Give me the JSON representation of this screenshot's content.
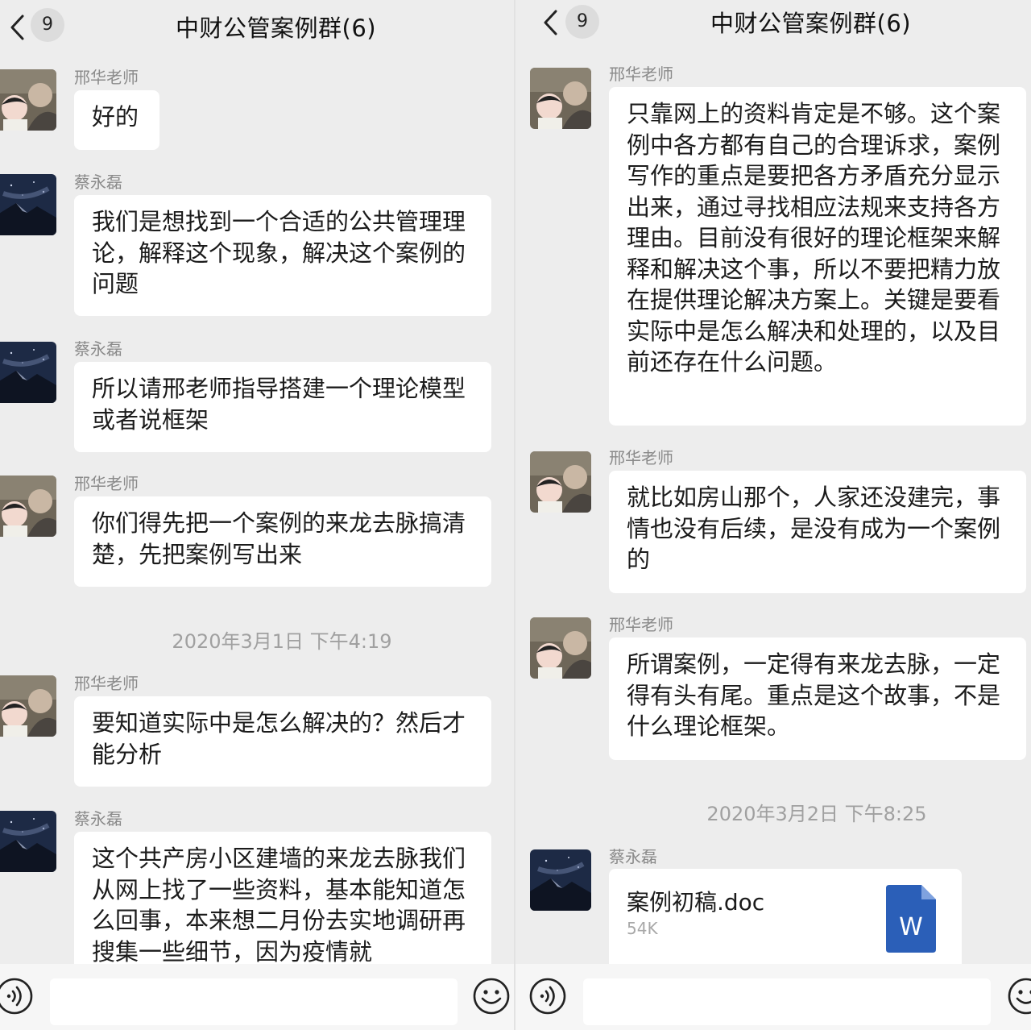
{
  "left": {
    "header": {
      "title": "中财公管案例群(6)",
      "unread_count": "9"
    },
    "messages": [
      {
        "sender": "邢华老师",
        "avatar": "teacher-avatar",
        "text": "好的"
      },
      {
        "sender": "蔡永磊",
        "avatar": "student-avatar",
        "text": "我们是想找到一个合适的公共管理理论，解释这个现象，解决这个案例的问题"
      },
      {
        "sender": "蔡永磊",
        "avatar": "student-avatar",
        "text": "所以请邢老师指导搭建一个理论模型或者说框架"
      },
      {
        "sender": "邢华老师",
        "avatar": "teacher-avatar",
        "text": "你们得先把一个案例的来龙去脉搞清楚，先把案例写出来"
      },
      {
        "sender": "邢华老师",
        "avatar": "teacher-avatar",
        "text": "要知道实际中是怎么解决的？然后才能分析"
      },
      {
        "sender": "蔡永磊",
        "avatar": "student-avatar",
        "text": "这个共产房小区建墙的来龙去脉我们从网上找了一些资料，基本能知道怎么回事，本来想二月份去实地调研再搜集一些细节，因为疫情就"
      }
    ],
    "timestamp": "2020年3月1日 下午4:19",
    "input": {
      "placeholder": ""
    }
  },
  "right": {
    "header": {
      "title": "中财公管案例群(6)",
      "unread_count": "9"
    },
    "messages": [
      {
        "sender": "邢华老师",
        "avatar": "teacher-avatar",
        "text": "只靠网上的资料肯定是不够。这个案例中各方都有自己的合理诉求，案例写作的重点是要把各方矛盾充分显示出来，通过寻找相应法规来支持各方理由。目前没有很好的理论框架来解释和解决这个事，所以不要把精力放在提供理论解决方案上。关键是要看实际中是怎么解决和处理的，以及目前还存在什么问题。"
      },
      {
        "sender": "邢华老师",
        "avatar": "teacher-avatar",
        "text": "就比如房山那个，人家还没建完，事情也没有后续，是没有成为一个案例的"
      },
      {
        "sender": "邢华老师",
        "avatar": "teacher-avatar",
        "text": "所谓案例，一定得有来龙去脉，一定得有头有尾。重点是这个故事，不是什么理论框架。"
      }
    ],
    "timestamp": "2020年3月2日 下午8:25",
    "file_message": {
      "sender": "蔡永磊",
      "avatar": "student-avatar",
      "file_name": "案例初稿.doc",
      "file_size": "54K",
      "file_icon": "word-doc-icon",
      "file_icon_letter": "W"
    },
    "input": {
      "placeholder": ""
    }
  },
  "colors": {
    "background": "#ededed",
    "bubble": "#ffffff",
    "sender_text": "#8a8a8a",
    "timestamp_text": "#a0a0a0",
    "word_icon": "#2b5fb8"
  }
}
